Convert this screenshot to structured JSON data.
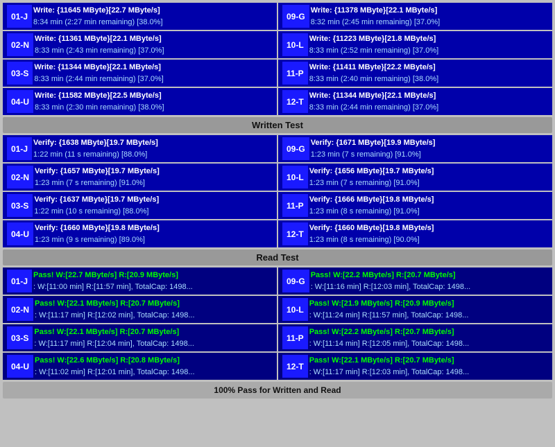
{
  "write_section": {
    "rows": [
      {
        "left": {
          "id": "01-J",
          "line1": "Write: {11645 MByte}[22.7 MByte/s]",
          "line2": "8:34 min (2:27 min remaining)  [38.0%]"
        },
        "right": {
          "id": "09-G",
          "line1": "Write: {11378 MByte}[22.1 MByte/s]",
          "line2": "8:32 min (2:45 min remaining)  [37.0%]"
        }
      },
      {
        "left": {
          "id": "02-N",
          "line1": "Write: {11361 MByte}[22.1 MByte/s]",
          "line2": "8:33 min (2:43 min remaining)  [37.0%]"
        },
        "right": {
          "id": "10-L",
          "line1": "Write: {11223 MByte}[21.8 MByte/s]",
          "line2": "8:33 min (2:52 min remaining)  [37.0%]"
        }
      },
      {
        "left": {
          "id": "03-S",
          "line1": "Write: {11344 MByte}[22.1 MByte/s]",
          "line2": "8:33 min (2:44 min remaining)  [37.0%]"
        },
        "right": {
          "id": "11-P",
          "line1": "Write: {11411 MByte}[22.2 MByte/s]",
          "line2": "8:33 min (2:40 min remaining)  [38.0%]"
        }
      },
      {
        "left": {
          "id": "04-U",
          "line1": "Write: {11582 MByte}[22.5 MByte/s]",
          "line2": "8:33 min (2:30 min remaining)  [38.0%]"
        },
        "right": {
          "id": "12-T",
          "line1": "Write: {11344 MByte}[22.1 MByte/s]",
          "line2": "8:33 min (2:44 min remaining)  [37.0%]"
        }
      }
    ],
    "header": "Written Test"
  },
  "verify_section": {
    "rows": [
      {
        "left": {
          "id": "01-J",
          "line1": "Verify: {1638 MByte}[19.7 MByte/s]",
          "line2": "1:22 min (11 s remaining)  [88.0%]"
        },
        "right": {
          "id": "09-G",
          "line1": "Verify: {1671 MByte}[19.9 MByte/s]",
          "line2": "1:23 min (7 s remaining)  [91.0%]"
        }
      },
      {
        "left": {
          "id": "02-N",
          "line1": "Verify: {1657 MByte}[19.7 MByte/s]",
          "line2": "1:23 min (7 s remaining)  [91.0%]"
        },
        "right": {
          "id": "10-L",
          "line1": "Verify: {1656 MByte}[19.7 MByte/s]",
          "line2": "1:23 min (7 s remaining)  [91.0%]"
        }
      },
      {
        "left": {
          "id": "03-S",
          "line1": "Verify: {1637 MByte}[19.7 MByte/s]",
          "line2": "1:22 min (10 s remaining)  [88.0%]"
        },
        "right": {
          "id": "11-P",
          "line1": "Verify: {1666 MByte}[19.8 MByte/s]",
          "line2": "1:23 min (8 s remaining)  [91.0%]"
        }
      },
      {
        "left": {
          "id": "04-U",
          "line1": "Verify: {1660 MByte}[19.8 MByte/s]",
          "line2": "1:23 min (9 s remaining)  [89.0%]"
        },
        "right": {
          "id": "12-T",
          "line1": "Verify: {1660 MByte}[19.8 MByte/s]",
          "line2": "1:23 min (8 s remaining)  [90.0%]"
        }
      }
    ],
    "header": "Read Test"
  },
  "pass_section": {
    "rows": [
      {
        "left": {
          "id": "01-J",
          "line1": "Pass! W:[22.7 MByte/s] R:[20.9 MByte/s]",
          "line2": ": W:[11:00 min] R:[11:57 min], TotalCap: 1498..."
        },
        "right": {
          "id": "09-G",
          "line1": "Pass! W:[22.2 MByte/s] R:[20.7 MByte/s]",
          "line2": ": W:[11:16 min] R:[12:03 min], TotalCap: 1498..."
        }
      },
      {
        "left": {
          "id": "02-N",
          "line1": "Pass! W:[22.1 MByte/s] R:[20.7 MByte/s]",
          "line2": ": W:[11:17 min] R:[12:02 min], TotalCap: 1498..."
        },
        "right": {
          "id": "10-L",
          "line1": "Pass! W:[21.9 MByte/s] R:[20.9 MByte/s]",
          "line2": ": W:[11:24 min] R:[11:57 min], TotalCap: 1498..."
        }
      },
      {
        "left": {
          "id": "03-S",
          "line1": "Pass! W:[22.1 MByte/s] R:[20.7 MByte/s]",
          "line2": ": W:[11:17 min] R:[12:04 min], TotalCap: 1498..."
        },
        "right": {
          "id": "11-P",
          "line1": "Pass! W:[22.2 MByte/s] R:[20.7 MByte/s]",
          "line2": ": W:[11:14 min] R:[12:05 min], TotalCap: 1498..."
        }
      },
      {
        "left": {
          "id": "04-U",
          "line1": "Pass! W:[22.6 MByte/s] R:[20.8 MByte/s]",
          "line2": ": W:[11:02 min] R:[12:01 min], TotalCap: 1498..."
        },
        "right": {
          "id": "12-T",
          "line1": "Pass! W:[22.1 MByte/s] R:[20.7 MByte/s]",
          "line2": ": W:[11:17 min] R:[12:03 min], TotalCap: 1498..."
        }
      }
    ]
  },
  "footer": "100% Pass for Written and Read"
}
